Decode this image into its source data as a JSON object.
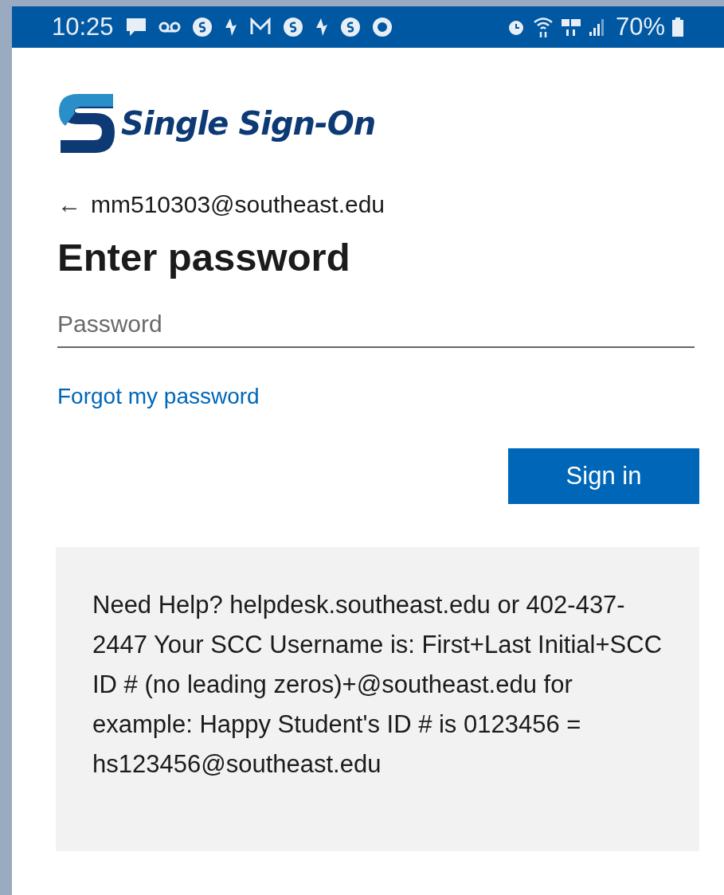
{
  "status_bar": {
    "time": "10:25",
    "battery": "70%"
  },
  "logo": {
    "text": "Single Sign-On"
  },
  "account": {
    "back": "←",
    "email": "mm510303@southeast.edu"
  },
  "heading": "Enter password",
  "password_field": {
    "placeholder": "Password"
  },
  "forgot_link": "Forgot my password",
  "sign_in_button": "Sign in",
  "help_text": "Need Help? helpdesk.southeast.edu or 402-437-2447 Your SCC Username is: First+Last Initial+SCC ID # (no leading zeros)+@southeast.edu for example: Happy Student's ID # is 0123456 = hs123456@southeast.edu"
}
